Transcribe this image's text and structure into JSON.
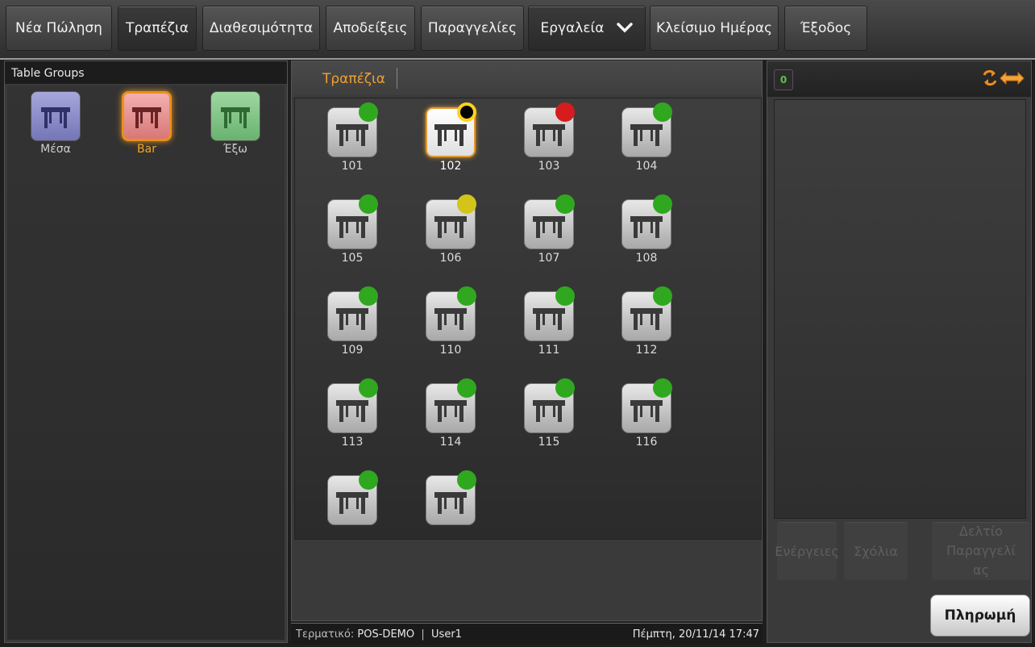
{
  "topnav": [
    {
      "label": "Νέα Πώληση"
    },
    {
      "label": "Τραπέζια"
    },
    {
      "label": "Διαθεσιμότητα"
    },
    {
      "label": "Αποδείξεις"
    },
    {
      "label": "Παραγγελίες"
    },
    {
      "label": "Εργαλεία"
    },
    {
      "label": "Κλείσιμο Ημέρας"
    },
    {
      "label": "Έξοδος"
    }
  ],
  "groups_panel": {
    "title": "Table Groups",
    "groups": [
      {
        "label": "Μέσα",
        "color": "#8d8ec8",
        "dark": "#2f3168",
        "selected": false
      },
      {
        "label": "Bar",
        "color": "#e99898",
        "dark": "#6b2424",
        "selected": true
      },
      {
        "label": "Έξω",
        "color": "#86c88a",
        "dark": "#2f6a33",
        "selected": false
      }
    ]
  },
  "tables_panel": {
    "tab_label": "Τραπέζια",
    "tables": [
      {
        "number": "101",
        "status_color": "#2fa81f",
        "selected": false
      },
      {
        "number": "102",
        "status_color": "#ffd21a",
        "selected": true
      },
      {
        "number": "103",
        "status_color": "#d61c1c",
        "selected": false
      },
      {
        "number": "104",
        "status_color": "#2fa81f",
        "selected": false
      },
      {
        "number": "105",
        "status_color": "#2fa81f",
        "selected": false
      },
      {
        "number": "106",
        "status_color": "#d4c41a",
        "selected": false
      },
      {
        "number": "107",
        "status_color": "#2fa81f",
        "selected": false
      },
      {
        "number": "108",
        "status_color": "#2fa81f",
        "selected": false
      },
      {
        "number": "109",
        "status_color": "#2fa81f",
        "selected": false
      },
      {
        "number": "110",
        "status_color": "#2fa81f",
        "selected": false
      },
      {
        "number": "111",
        "status_color": "#2fa81f",
        "selected": false
      },
      {
        "number": "112",
        "status_color": "#2fa81f",
        "selected": false
      },
      {
        "number": "113",
        "status_color": "#2fa81f",
        "selected": false
      },
      {
        "number": "114",
        "status_color": "#2fa81f",
        "selected": false
      },
      {
        "number": "115",
        "status_color": "#2fa81f",
        "selected": false
      },
      {
        "number": "116",
        "status_color": "#2fa81f",
        "selected": false
      },
      {
        "number": "",
        "status_color": "#2fa81f",
        "selected": false
      },
      {
        "number": "",
        "status_color": "#2fa81f",
        "selected": false
      }
    ]
  },
  "statusbar": {
    "terminal_label": "Τερματικό:",
    "terminal_value": "POS-DEMO",
    "separator": "|",
    "user": "User1",
    "datetime": "Πέμπτη, 20/11/14 17:47"
  },
  "order_panel": {
    "item_count": "0",
    "swap_icon": "swap-arrows-icon",
    "actions_label": "Ενέργειες",
    "comments_label": "Σχόλια",
    "order_slip_label": "Δελτίο Παραγγελί ας",
    "payment_label": "Πληρωμή"
  }
}
